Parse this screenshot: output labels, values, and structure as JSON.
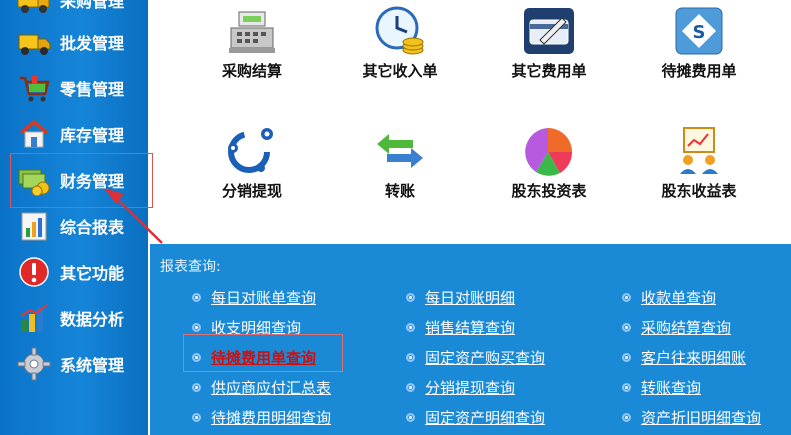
{
  "sidebar": {
    "items": [
      {
        "label": "采购管理",
        "icon": "purchase-truck-icon"
      },
      {
        "label": "批发管理",
        "icon": "wholesale-truck-icon"
      },
      {
        "label": "零售管理",
        "icon": "retail-cart-icon"
      },
      {
        "label": "库存管理",
        "icon": "inventory-house-icon"
      },
      {
        "label": "财务管理",
        "icon": "finance-money-icon"
      },
      {
        "label": "综合报表",
        "icon": "report-chart-icon"
      },
      {
        "label": "其它功能",
        "icon": "other-alert-icon"
      },
      {
        "label": "数据分析",
        "icon": "analysis-bars-icon"
      },
      {
        "label": "系统管理",
        "icon": "system-gear-icon"
      }
    ],
    "active_label": "财务管理"
  },
  "grid": {
    "items": [
      {
        "label": "采购结算",
        "icon": "cash-register-icon"
      },
      {
        "label": "其它收入单",
        "icon": "clock-coins-icon"
      },
      {
        "label": "其它费用单",
        "icon": "card-pen-icon"
      },
      {
        "label": "待摊费用单",
        "icon": "s-badge-icon"
      },
      {
        "label": "分销提现",
        "icon": "gear-ring-icon"
      },
      {
        "label": "转账",
        "icon": "transfer-arrows-icon"
      },
      {
        "label": "股东投资表",
        "icon": "pie-chart-icon"
      },
      {
        "label": "股东收益表",
        "icon": "presentation-people-icon"
      }
    ]
  },
  "report": {
    "title": "报表查询:",
    "links": [
      [
        "每日对账单查询",
        "每日对账明细",
        "收款单查询"
      ],
      [
        "收支明细查询",
        "销售结算查询",
        "采购结算查询"
      ],
      [
        "待摊费用单查询",
        "固定资产购买查询",
        "客户往来明细账"
      ],
      [
        "供应商应付汇总表",
        "分销提现查询",
        "转账查询"
      ],
      [
        "待摊费用明细查询",
        "固定资产明细查询",
        "资产折旧明细查询"
      ]
    ],
    "active_link": "待摊费用单查询"
  },
  "colors": {
    "sidebar_bg": "#1585d8",
    "report_bg": "#1a8ad7",
    "highlight": "#d9555a",
    "active_link": "#cc1111"
  }
}
